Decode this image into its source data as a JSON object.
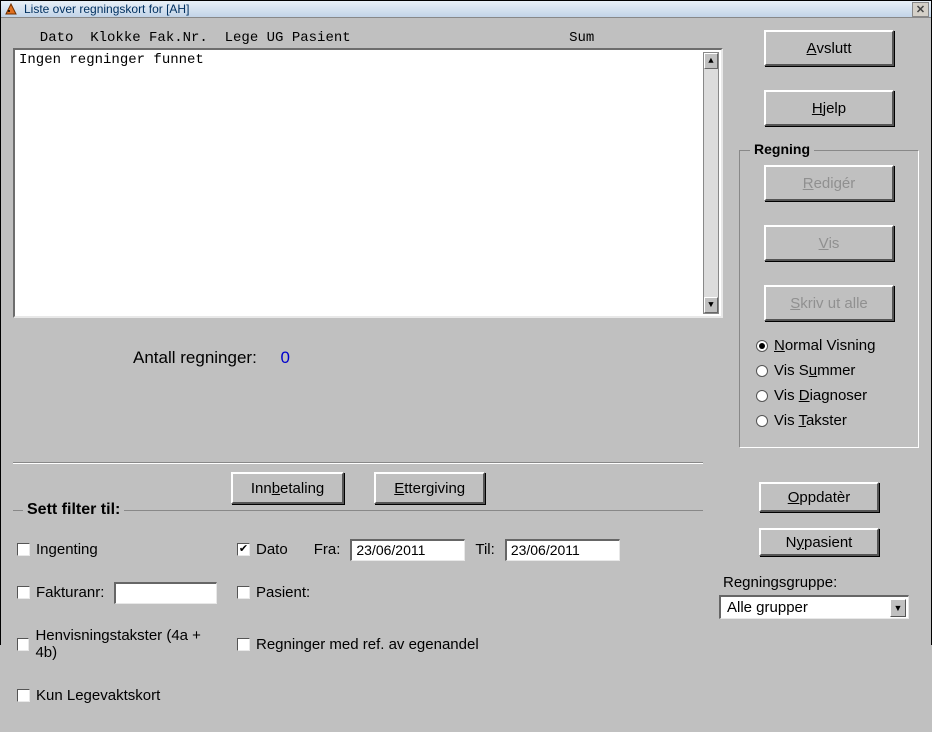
{
  "title": "Liste over regningskort for [AH]",
  "headers": "  Dato  Klokke Fak.Nr.  Lege UG Pasient                          Sum",
  "list_empty": "Ingen regninger funnet",
  "count_label": "Antall regninger:",
  "count_value": "0",
  "buttons": {
    "avslutt_pre": "",
    "avslutt_u": "A",
    "avslutt_post": "vslutt",
    "hjelp_pre": "",
    "hjelp_u": "H",
    "hjelp_post": "jelp",
    "rediger_pre": "",
    "rediger_u": "R",
    "rediger_post": "edigér",
    "vis_pre": "",
    "vis_u": "V",
    "vis_post": "is",
    "skrivut_pre": "",
    "skrivut_u": "S",
    "skrivut_post": "kriv ut alle",
    "innbetaling_pre": "Inn",
    "innbetaling_u": "b",
    "innbetaling_post": "etaling",
    "ettergiving_pre": "",
    "ettergiving_u": "E",
    "ettergiving_post": "ttergiving",
    "oppdater_pre": "",
    "oppdater_u": "O",
    "oppdater_post": "ppdatèr",
    "nypasient_pre": "N",
    "nypasient_u": "y",
    "nypasient_post": " pasient"
  },
  "regning_legend": "Regning",
  "view": {
    "normal_pre": "",
    "normal_u": "N",
    "normal_post": "ormal Visning",
    "summer_pre": "Vis S",
    "summer_u": "u",
    "summer_post": "mmer",
    "diagnoser_pre": "Vis ",
    "diagnoser_u": "D",
    "diagnoser_post": "iagnoser",
    "takster_pre": "Vis ",
    "takster_u": "T",
    "takster_post": "akster"
  },
  "filter_legend": "Sett filter til:",
  "filter": {
    "ingenting": "Ingenting",
    "dato": "Dato",
    "fra_label": "Fra:",
    "fra_value": "23/06/2011",
    "til_label": "Til:",
    "til_value": "23/06/2011",
    "fakturanr": "Fakturanr:",
    "fakturanr_value": "",
    "pasient": "Pasient:",
    "henvisning": "Henvisningstakster (4a + 4b)",
    "ref_egenandel": "Regninger med ref. av egenandel",
    "legevakt": "Kun Legevaktskort"
  },
  "regningsgruppe_label": "Regningsgruppe:",
  "regningsgruppe_value": "Alle grupper"
}
